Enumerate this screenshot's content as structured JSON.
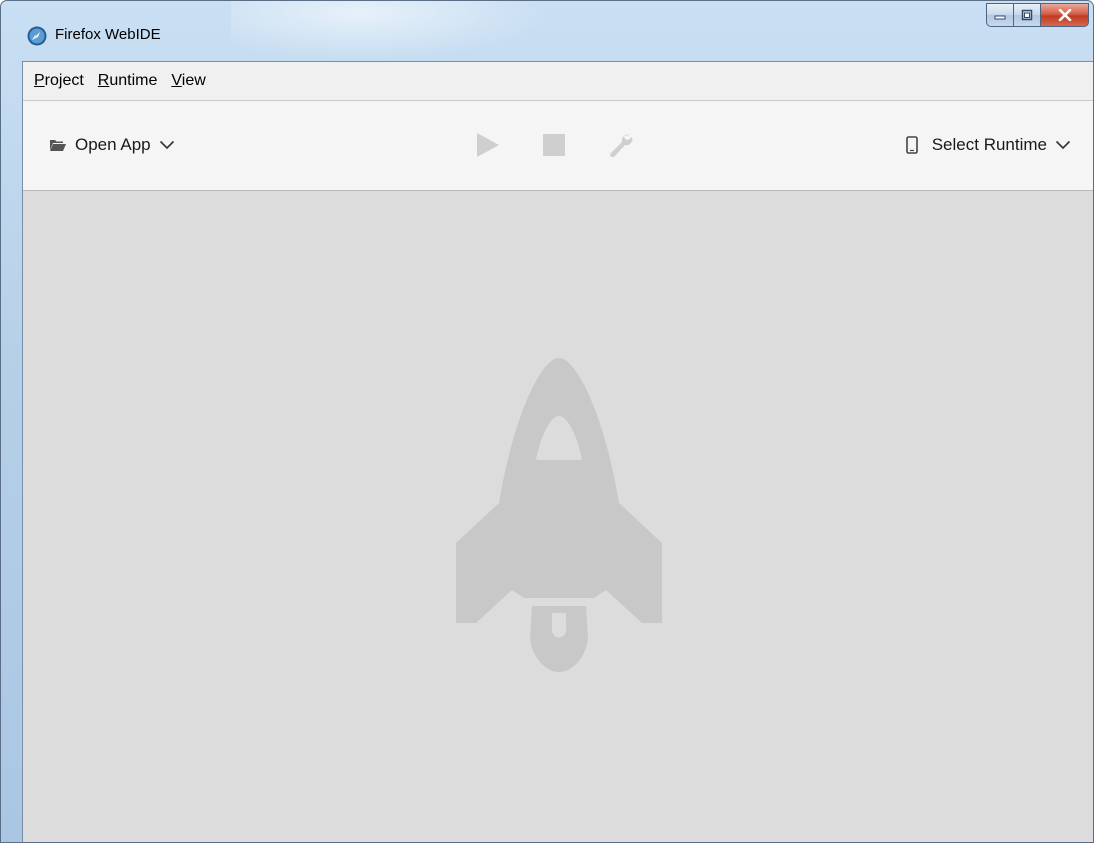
{
  "window": {
    "title": "Firefox WebIDE",
    "caption_buttons": [
      "minimize",
      "maximize",
      "close"
    ]
  },
  "menubar": {
    "items": [
      {
        "label": "Project",
        "accel": "P",
        "rest": "roject"
      },
      {
        "label": "Runtime",
        "accel": "R",
        "rest": "untime"
      },
      {
        "label": "View",
        "accel": "V",
        "rest": "iew"
      }
    ]
  },
  "toolbar": {
    "open_app_label": "Open App",
    "open_app_icon": "folder-open-icon",
    "play_icon": "play-icon",
    "stop_icon": "stop-icon",
    "debug_icon": "wrench-icon",
    "select_runtime_label": "Select Runtime",
    "select_runtime_icon": "phone-icon"
  },
  "main": {
    "watermark_icon": "rocket-icon"
  },
  "colors": {
    "titlebar": "#b5cfe8",
    "toolbar_bg": "#f5f5f5",
    "main_bg": "#dcdcdc",
    "disabled_icon": "#cfcfcf",
    "rocket": "#c8c8c8"
  }
}
